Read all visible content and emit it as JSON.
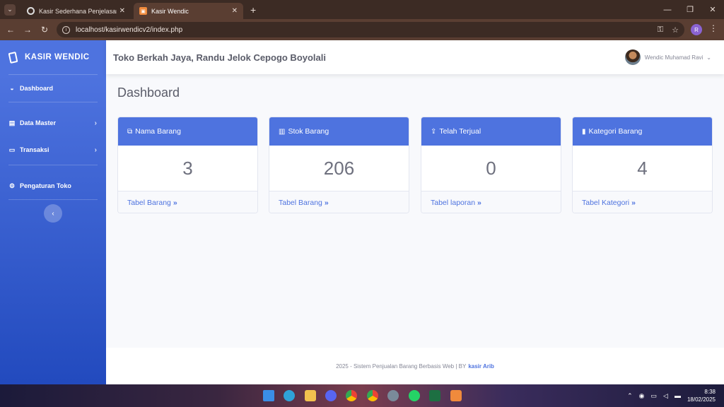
{
  "browser": {
    "tabs": [
      {
        "title": "Kasir Sederhana Penjelasan",
        "active": false
      },
      {
        "title": "Kasir Wendic",
        "active": true
      }
    ],
    "url": "localhost/kasirwendicv2/index.php",
    "profile_initial": "R"
  },
  "sidebar": {
    "brand": "KASIR WENDIC",
    "items": [
      {
        "label": "Dashboard",
        "icon": "tachometer-icon"
      },
      {
        "label": "Data Master",
        "icon": "database-icon"
      },
      {
        "label": "Transaksi",
        "icon": "desktop-icon"
      },
      {
        "label": "Pengaturan Toko",
        "icon": "cogs-icon"
      }
    ]
  },
  "topbar": {
    "store_name": "Toko Berkah Jaya, Randu Jelok Cepogo Boyolali",
    "user_name": "Wendic Muhamad Ravi"
  },
  "page": {
    "title": "Dashboard"
  },
  "cards": [
    {
      "title": "Nama Barang",
      "value": "3",
      "link": "Tabel Barang",
      "icon": "cubes-icon"
    },
    {
      "title": "Stok Barang",
      "value": "206",
      "link": "Tabel Barang",
      "icon": "chart-bar-icon"
    },
    {
      "title": "Telah Terjual",
      "value": "0",
      "link": "Tabel laporan",
      "icon": "upload-icon"
    },
    {
      "title": "Kategori Barang",
      "value": "4",
      "link": "Tabel Kategori",
      "icon": "bookmark-icon"
    }
  ],
  "footer": {
    "text": "2025 - Sistem Penjualan Barang Berbasis Web | BY",
    "author": "kasir Arib"
  },
  "taskbar": {
    "time": "8:38",
    "date": "18/02/2025"
  },
  "colors": {
    "primary": "#4e73df",
    "sidebar_end": "#224abe",
    "text_muted": "#858796"
  }
}
